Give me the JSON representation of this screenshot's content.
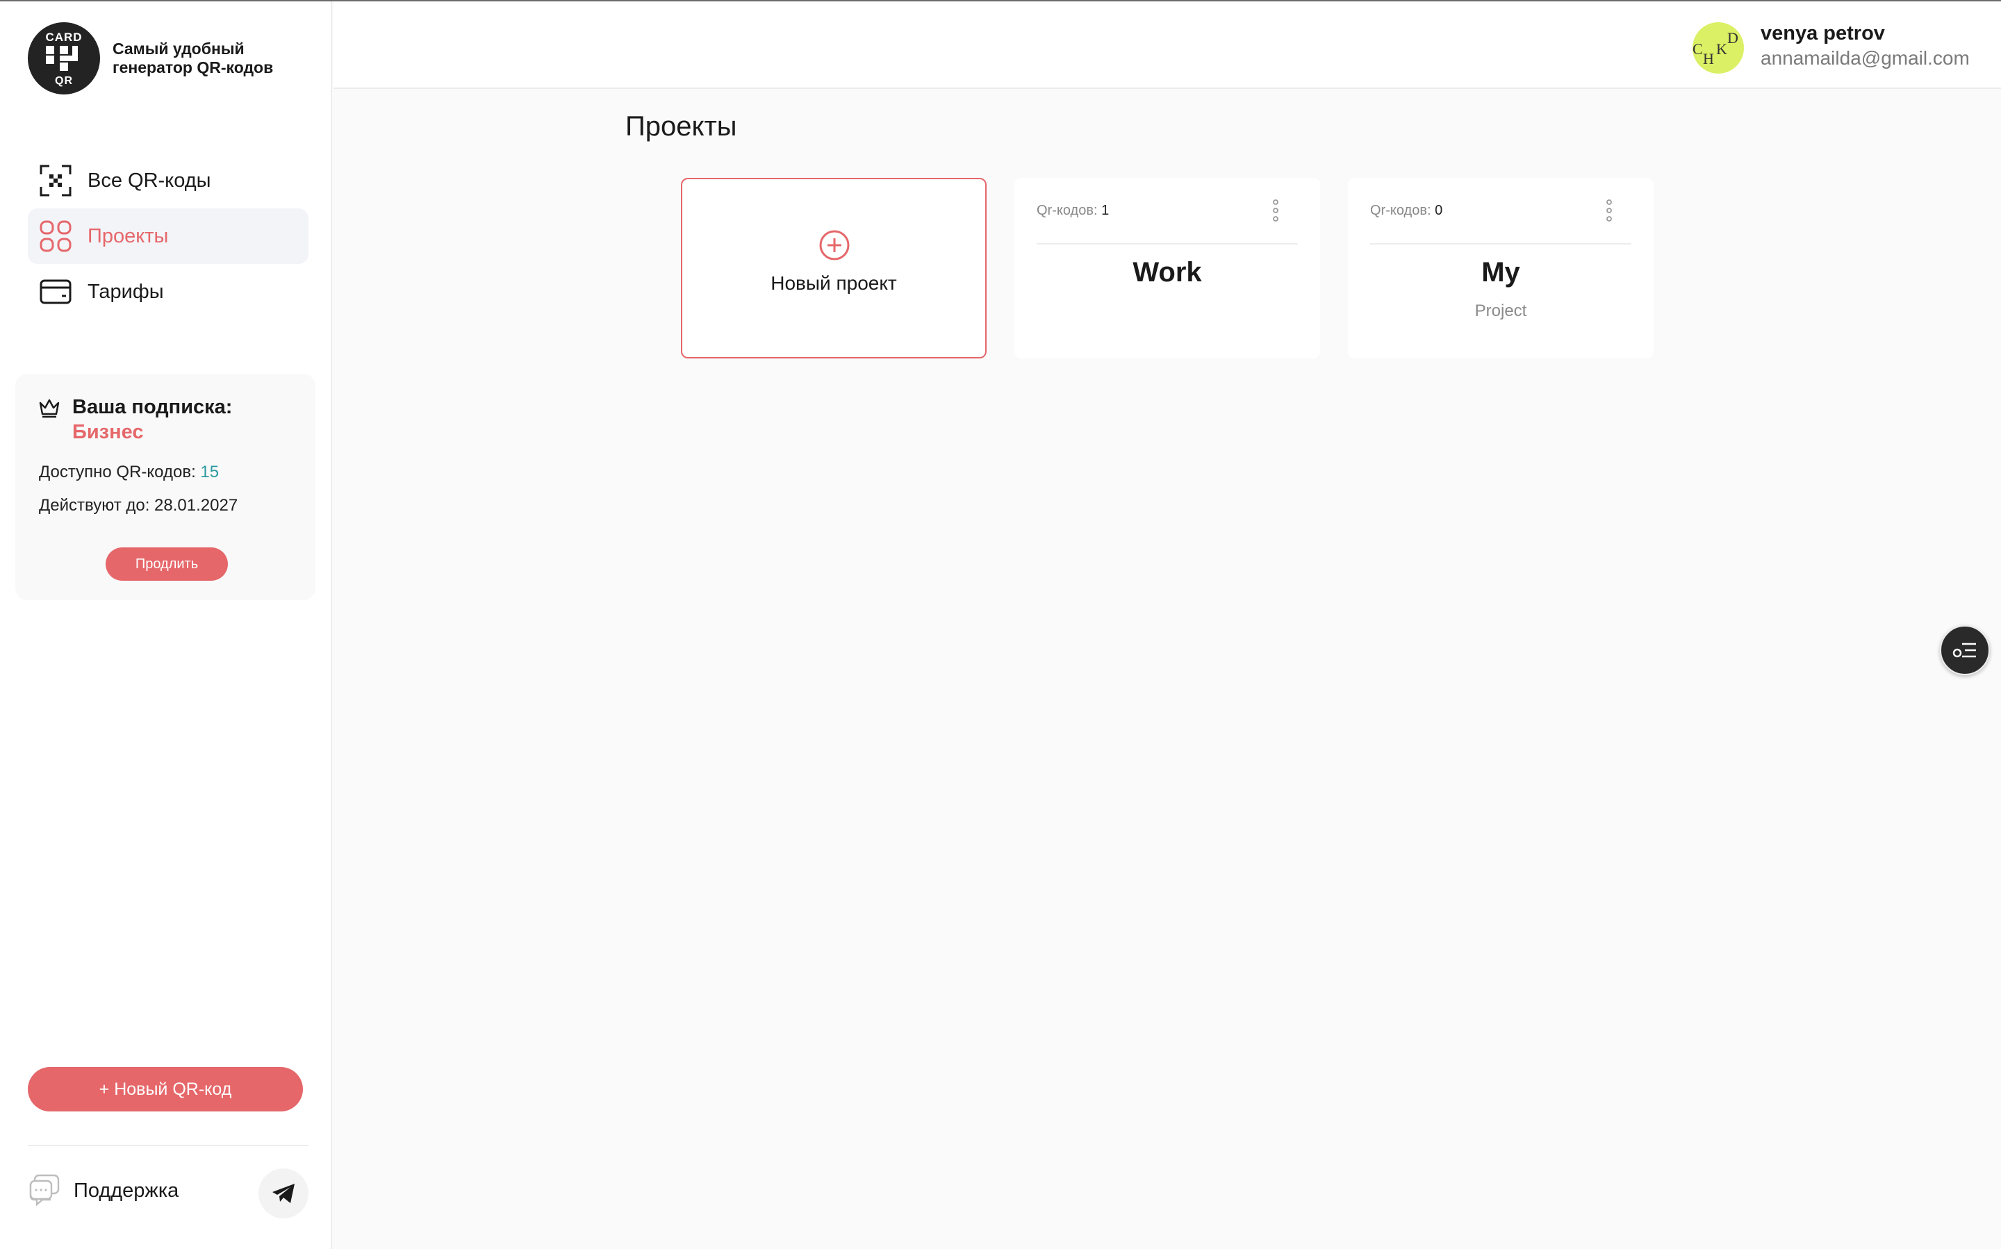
{
  "brand": {
    "logo_top": "CARD",
    "logo_bottom": "QR",
    "tagline": "Самый удобный генератор QR-кодов"
  },
  "nav": {
    "items": [
      {
        "label": "Все QR-коды",
        "icon": "qr-scan-icon"
      },
      {
        "label": "Проекты",
        "icon": "grid-icon",
        "active": true
      },
      {
        "label": "Тарифы",
        "icon": "wallet-icon"
      }
    ]
  },
  "subscription": {
    "title": "Ваша подписка:",
    "plan": "Бизнес",
    "available_label": "Доступно QR-кодов:",
    "available_count": "15",
    "valid_until_label": "Действуют до:",
    "valid_until": "28.01.2027",
    "extend_label": "Продлить"
  },
  "sidebar_bottom": {
    "new_qr_label": "+ Новый QR-код",
    "support_label": "Поддержка"
  },
  "user": {
    "name": "venya petrov",
    "email": "annamailda@gmail.com",
    "avatar_letters": [
      "C",
      "H",
      "K",
      "D"
    ]
  },
  "main": {
    "title": "Проекты",
    "new_project_label": "Новый проект",
    "count_label": "Qr-кодов:",
    "projects": [
      {
        "count": "1",
        "name": "Work",
        "description": ""
      },
      {
        "count": "0",
        "name": "My",
        "description": "Project"
      }
    ]
  },
  "colors": {
    "accent": "#e5676a",
    "avatar_bg": "#dbf064",
    "count_highlight": "#2c9aa0"
  }
}
